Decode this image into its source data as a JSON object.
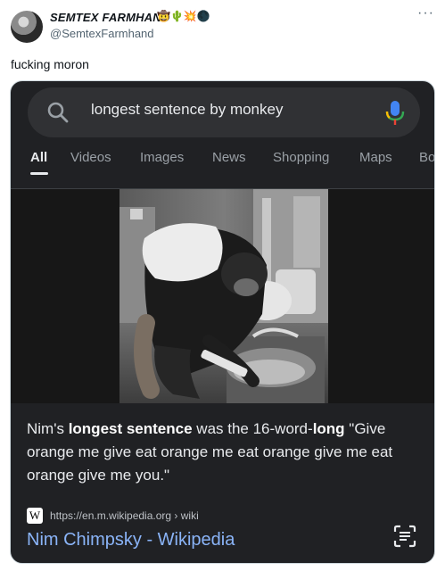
{
  "tweet": {
    "display_name": "SEMTEX FARMHAND",
    "name_emojis": "🤠🌵💥🌑",
    "handle": "@SemtexFarmhand",
    "more_label": "···",
    "text": "fucking moron"
  },
  "search": {
    "query": "longest sentence by monkey"
  },
  "tabs": [
    {
      "label": "All",
      "active": true
    },
    {
      "label": "Videos"
    },
    {
      "label": "Images"
    },
    {
      "label": "News"
    },
    {
      "label": "Shopping"
    },
    {
      "label": "Maps"
    },
    {
      "label": "Bo"
    }
  ],
  "answer": {
    "part1": "Nim's ",
    "bold1": "longest sentence",
    "part2": " was the 16-word-",
    "bold2": "long",
    "part3": " \"Give orange me give eat orange me eat orange give me eat orange give me you.\""
  },
  "result": {
    "favicon_letter": "W",
    "url": "https://en.m.wikipedia.org › wiki",
    "title": "Nim Chimpsky - Wikipedia"
  },
  "colors": {
    "card_bg": "#202124",
    "search_bg": "#303134",
    "link_blue": "#8ab4f8",
    "mic_blue": "#4285f4",
    "mic_red": "#ea4335"
  }
}
